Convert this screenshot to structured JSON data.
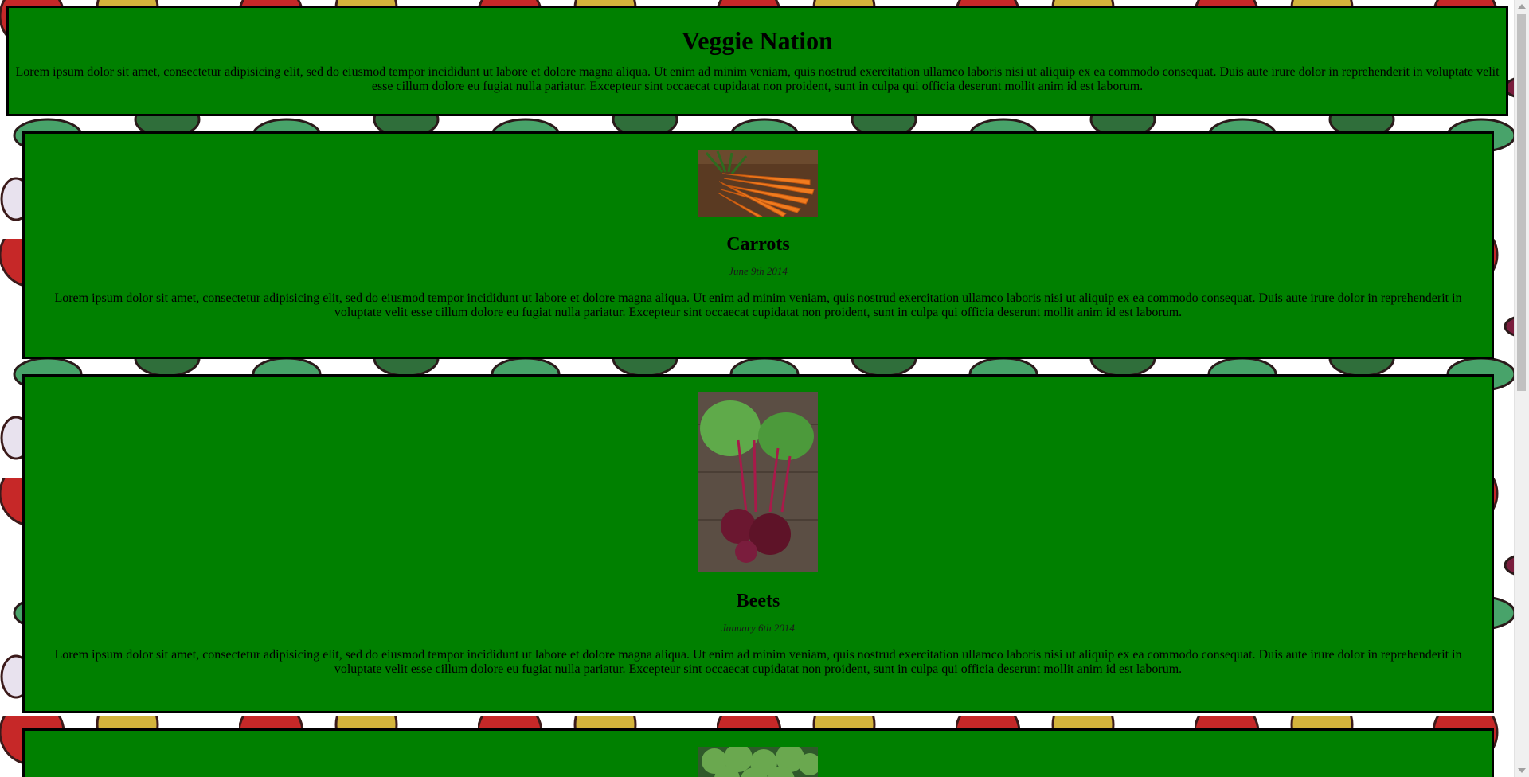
{
  "site": {
    "title": "Veggie Nation",
    "intro": "Lorem ipsum dolor sit amet, consectetur adipisicing elit, sed do eiusmod tempor incididunt ut labore et dolore magna aliqua. Ut enim ad minim veniam, quis nostrud exercitation ullamco laboris nisi ut aliquip ex ea commodo consequat. Duis aute irure dolor in reprehenderit in voluptate velit esse cillum dolore eu fugiat nulla pariatur. Excepteur sint occaecat cupidatat non proident, sunt in culpa qui officia deserunt mollit anim id est laborum."
  },
  "articles": [
    {
      "name": "Carrots",
      "date": "June 9th 2014",
      "body": "Lorem ipsum dolor sit amet, consectetur adipisicing elit, sed do eiusmod tempor incididunt ut labore et dolore magna aliqua. Ut enim ad minim veniam, quis nostrud exercitation ullamco laboris nisi ut aliquip ex ea commodo consequat. Duis aute irure dolor in reprehenderit in voluptate velit esse cillum dolore eu fugiat nulla pariatur. Excepteur sint occaecat cupidatat non proident, sunt in culpa qui officia deserunt mollit anim id est laborum.",
      "image": "carrots-photo"
    },
    {
      "name": "Beets",
      "date": "January 6th 2014",
      "body": "Lorem ipsum dolor sit amet, consectetur adipisicing elit, sed do eiusmod tempor incididunt ut labore et dolore magna aliqua. Ut enim ad minim veniam, quis nostrud exercitation ullamco laboris nisi ut aliquip ex ea commodo consequat. Duis aute irure dolor in reprehenderit in voluptate velit esse cillum dolore eu fugiat nulla pariatur. Excepteur sint occaecat cupidatat non proident, sunt in culpa qui officia deserunt mollit anim id est laborum.",
      "image": "beets-photo"
    },
    {
      "image": "broccoli-photo"
    }
  ],
  "colors": {
    "panel": "#008000",
    "border": "#000000"
  }
}
